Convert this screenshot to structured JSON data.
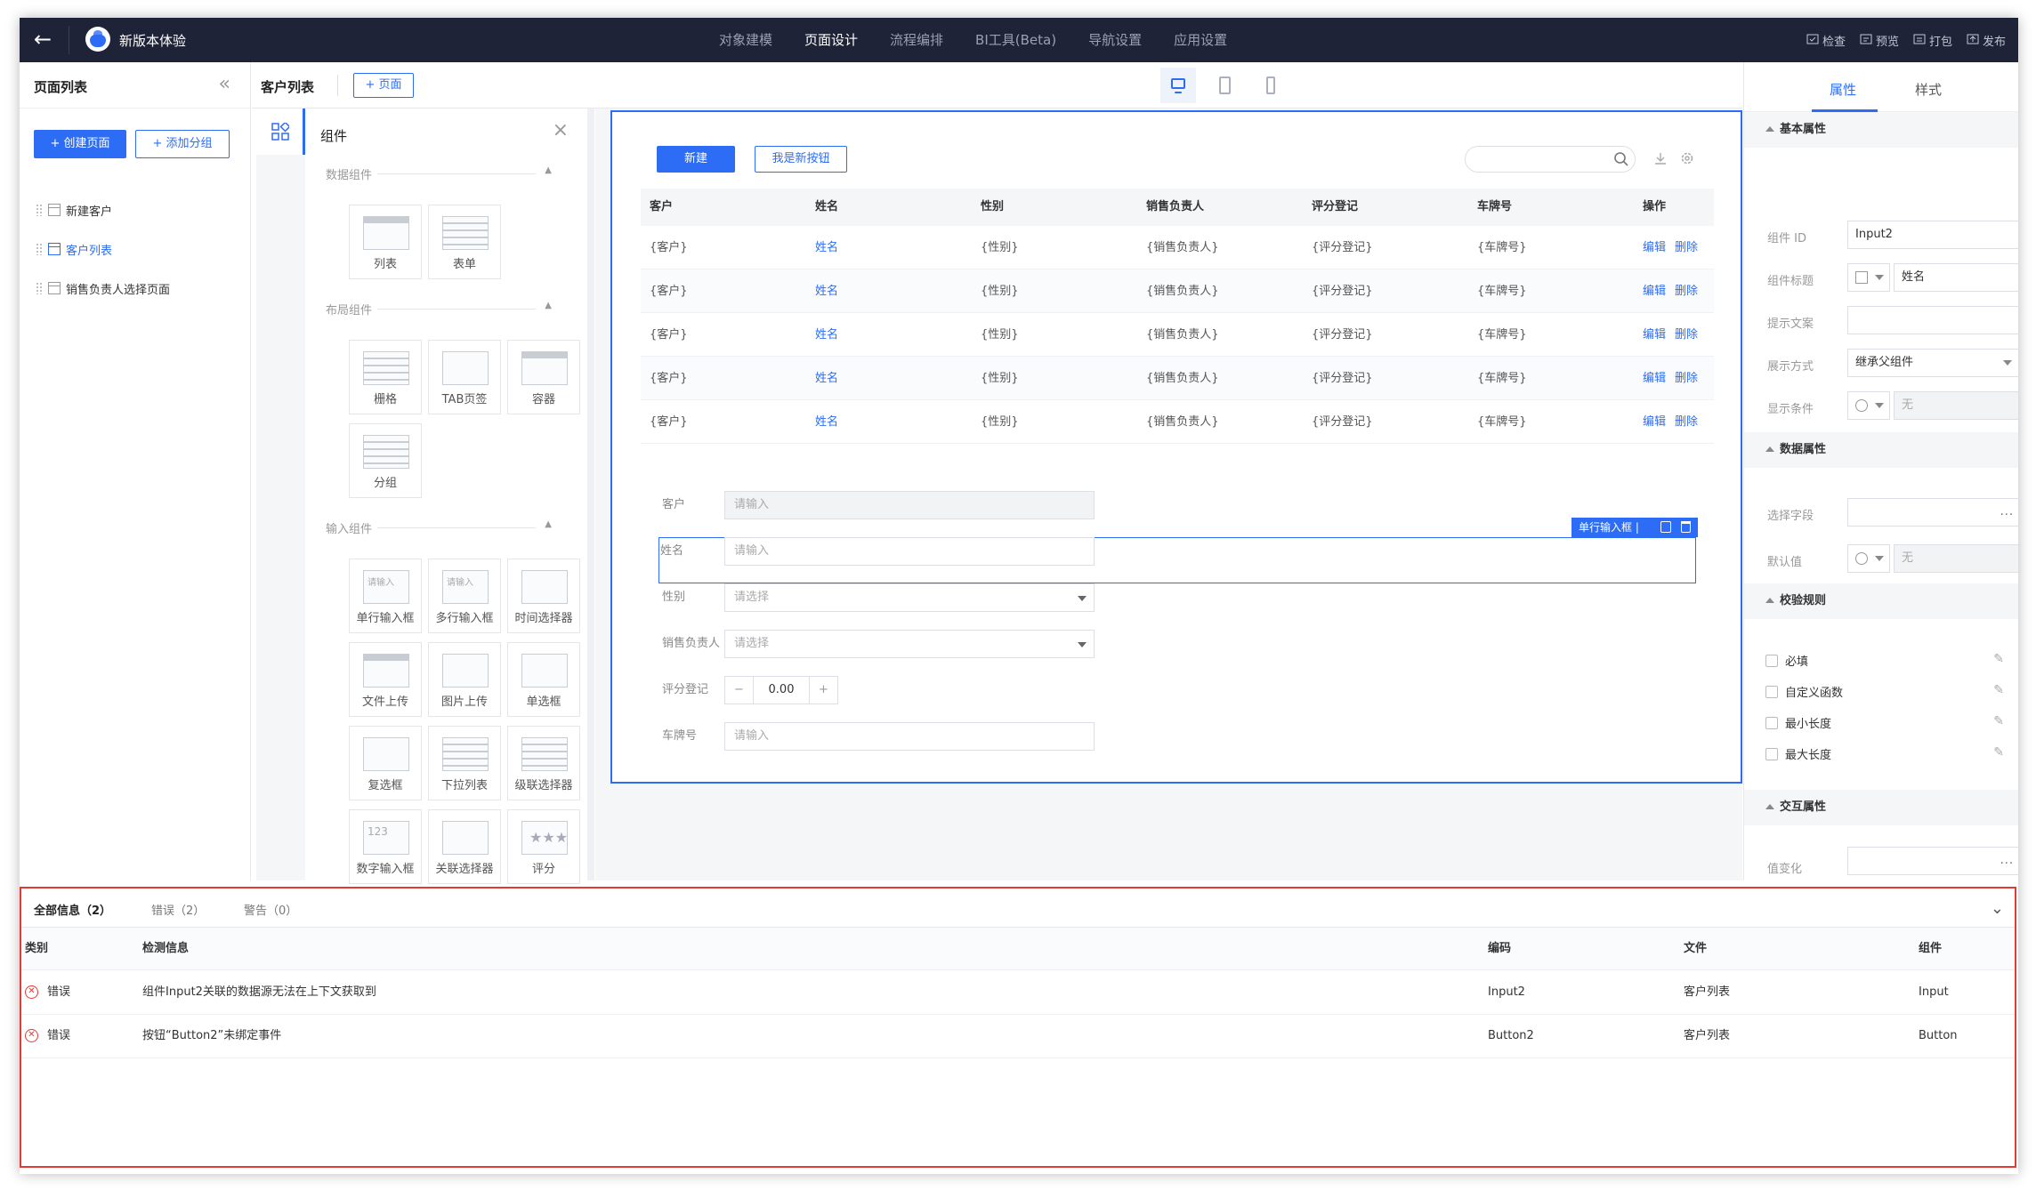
{
  "app": {
    "name": "新版本体验"
  },
  "nav": [
    "对象建模",
    "页面设计",
    "流程编排",
    "BI工具(Beta)",
    "导航设置",
    "应用设置"
  ],
  "nav_active": 1,
  "tools": [
    "检查",
    "预览",
    "打包",
    "发布"
  ],
  "left_panel": {
    "title": "页面列表",
    "create_btn": "+ 创建页面",
    "add_group_btn": "+ 添加分组",
    "pages": [
      "新建客户",
      "客户列表",
      "销售负责人选择页面"
    ],
    "active_page": 1
  },
  "tabbar": {
    "title": "客户列表",
    "add_page": "+ 页面"
  },
  "components": {
    "title": "组件",
    "sections": [
      "数据组件",
      "布局组件",
      "输入组件"
    ],
    "data_items": [
      "列表",
      "表单"
    ],
    "layout_items": [
      "栅格",
      "TAB页签",
      "容器",
      "分组"
    ],
    "input_items": [
      "单行输入框",
      "多行输入框",
      "时间选择器",
      "文件上传",
      "图片上传",
      "单选框",
      "复选框",
      "下拉列表",
      "级联选择器",
      "数字输入框",
      "关联选择器",
      "评分"
    ],
    "placeholder": "请输入",
    "number_sample": "123"
  },
  "canvas": {
    "new_btn": "新建",
    "new_btn2": "我是新按钮",
    "columns": [
      "客户",
      "姓名",
      "性别",
      "销售负责人",
      "评分登记",
      "车牌号",
      "操作"
    ],
    "rows": [
      [
        "{客户}",
        "姓名",
        "{性别}",
        "{销售负责人}",
        "{评分登记}",
        "{车牌号}"
      ],
      [
        "{客户}",
        "姓名",
        "{性别}",
        "{销售负责人}",
        "{评分登记}",
        "{车牌号}"
      ],
      [
        "{客户}",
        "姓名",
        "{性别}",
        "{销售负责人}",
        "{评分登记}",
        "{车牌号}"
      ],
      [
        "{客户}",
        "姓名",
        "{性别}",
        "{销售负责人}",
        "{评分登记}",
        "{车牌号}"
      ],
      [
        "{客户}",
        "姓名",
        "{性别}",
        "{销售负责人}",
        "{评分登记}",
        "{车牌号}"
      ]
    ],
    "edit": "编辑",
    "delete": "删除",
    "form": [
      {
        "label": "客户",
        "placeholder": "请输入"
      },
      {
        "label": "姓名",
        "placeholder": "请输入"
      },
      {
        "label": "性别",
        "placeholder": "请选择"
      },
      {
        "label": "销售负责人",
        "placeholder": "请选择"
      },
      {
        "label": "评分登记",
        "value": "0.00"
      },
      {
        "label": "车牌号",
        "placeholder": "请输入"
      }
    ],
    "selected_tag": "单行输入框 |"
  },
  "right_panel": {
    "tabs": [
      "属性",
      "样式"
    ],
    "basic_title": "基本属性",
    "fields": [
      {
        "label": "组件 ID",
        "value": "Input2"
      },
      {
        "label": "组件标题",
        "value": "姓名"
      },
      {
        "label": "提示文案",
        "value": ""
      },
      {
        "label": "展示方式",
        "value": "继承父组件"
      },
      {
        "label": "显示条件",
        "value": "无"
      }
    ],
    "data_title": "数据属性",
    "data_fields": [
      {
        "label": "选择字段",
        "value": "..."
      },
      {
        "label": "默认值",
        "value": "无"
      }
    ],
    "rules_title": "校验规则",
    "rules": [
      "必填",
      "自定义函数",
      "最小长度",
      "最大长度"
    ],
    "interact_title": "交互属性",
    "interact_fields": [
      {
        "label": "值变化",
        "value": "..."
      }
    ]
  },
  "issues": {
    "tabs": [
      "全部信息（2）",
      "错误（2）",
      "警告（0）"
    ],
    "columns": [
      "类别",
      "检测信息",
      "编码",
      "文件",
      "组件"
    ],
    "rows": [
      {
        "type": "错误",
        "msg": "组件Input2关联的数据源无法在上下文获取到",
        "code": "Input2",
        "file": "客户列表",
        "comp": "Input"
      },
      {
        "type": "错误",
        "msg": "按钮“Button2”未绑定事件",
        "code": "Button2",
        "file": "客户列表",
        "comp": "Button"
      }
    ]
  },
  "colors": {
    "topbar": "#1f2337",
    "accent": "#2d6df6",
    "error": "#e53935"
  }
}
